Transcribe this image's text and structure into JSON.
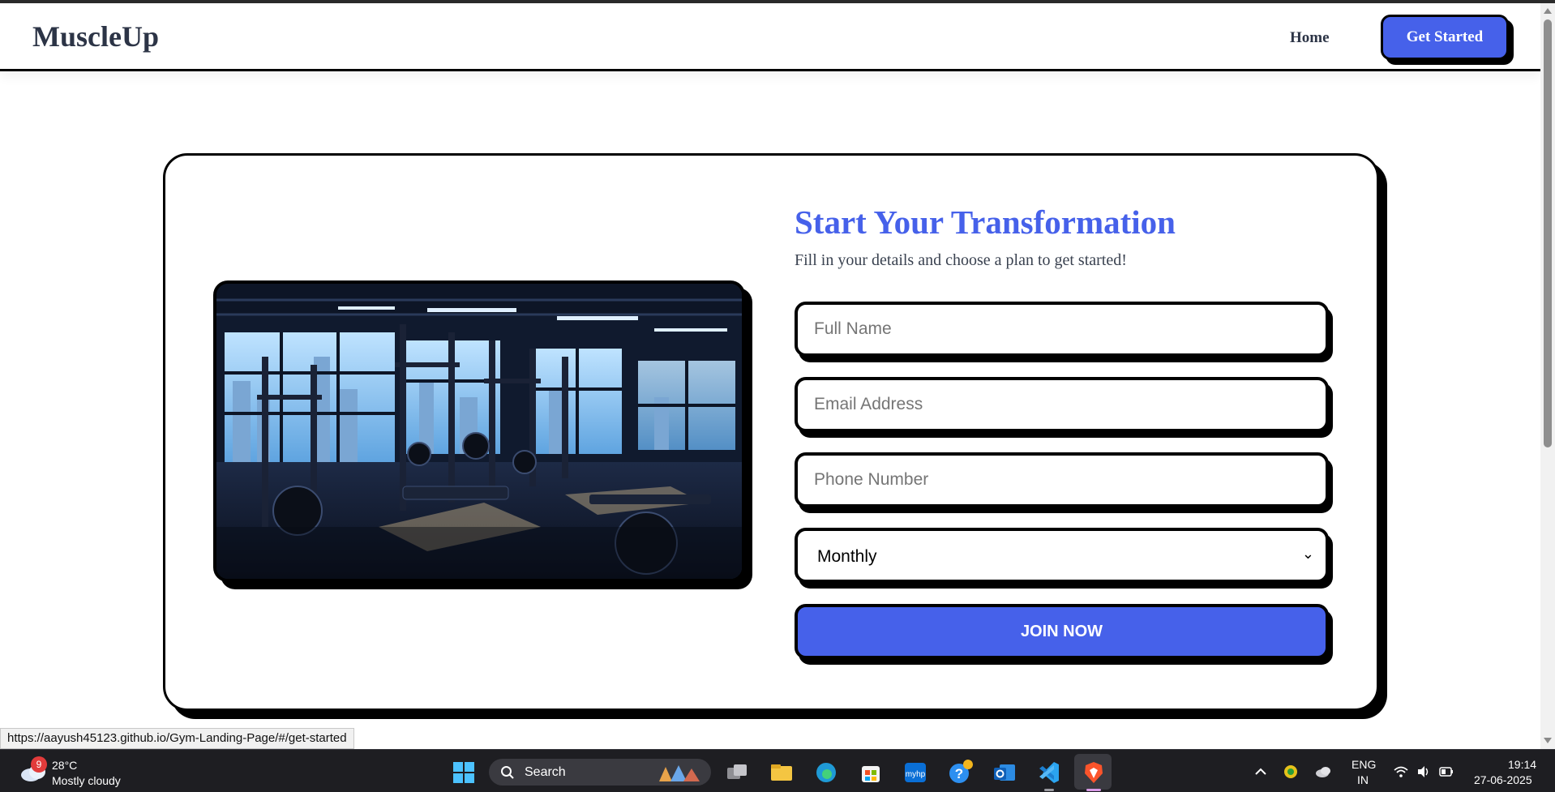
{
  "navbar": {
    "logo": "MuscleUp",
    "home_link": "Home",
    "cta_button": "Get Started"
  },
  "hero": {
    "image_alt": "Gym interior with weight racks and city view",
    "title": "Start Your Transformation",
    "subtitle": "Fill in your details and choose a plan to get started!"
  },
  "form": {
    "full_name_placeholder": "Full Name",
    "email_placeholder": "Email Address",
    "phone_placeholder": "Phone Number",
    "plan_selected": "Monthly",
    "submit_label": "JOIN NOW"
  },
  "status_bar": {
    "url": "https://aayush45123.github.io/Gym-Landing-Page/#/get-started"
  },
  "taskbar": {
    "weather_badge": "9",
    "temperature": "28°C",
    "weather_desc": "Mostly cloudy",
    "search_label": "Search",
    "lang_top": "ENG",
    "lang_bottom": "IN",
    "time": "19:14",
    "date": "27-06-2025"
  },
  "colors": {
    "accent": "#4661ea",
    "text_dark": "#2c3446",
    "border": "#000000"
  }
}
